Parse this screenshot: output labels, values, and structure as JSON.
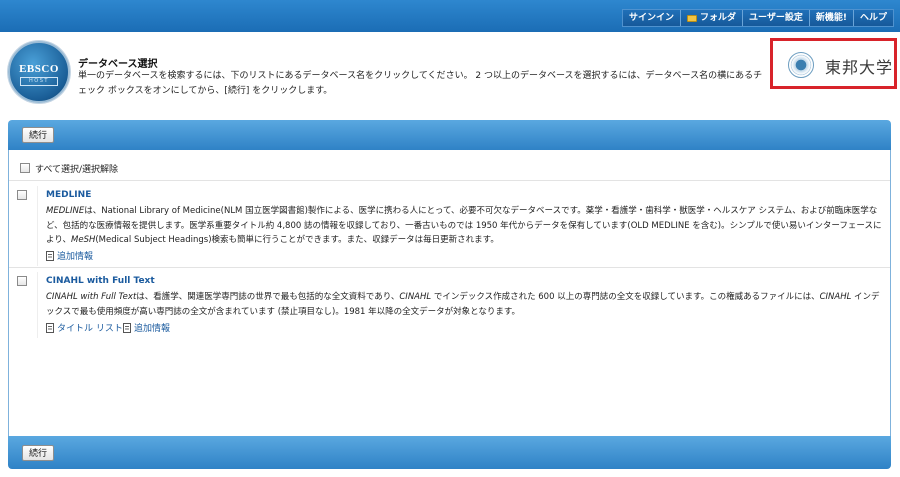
{
  "topnav": {
    "signin": "サインイン",
    "folder": "フォルダ",
    "user_settings": "ユーザー設定",
    "new_features": "新機能!",
    "help": "ヘルプ"
  },
  "header": {
    "logo_text": "EBSCO",
    "logo_sub": "HOST",
    "title": "データベース選択",
    "instructions": "単一のデータベースを検索するには、下のリストにあるデータベース名をクリックしてください。 2 つ以上のデータベースを選択するには、データベース名の横にあるチェック ボックスをオンにしてから、[続行] をクリックします。",
    "university": "東邦大学"
  },
  "toolbar": {
    "continue_label": "続行"
  },
  "select_all_label": "すべて選択/選択解除",
  "databases": [
    {
      "name": "MEDLINE",
      "desc_italic_1": "MEDLINE",
      "desc_1": "は、National Library of Medicine(NLM 国立医学図書館)製作による、医学に携わる人にとって、必要不可欠なデータベースです。薬学・看護学・歯科学・獣医学・ヘルスケア システム、および前臨床医学など、包括的な医療情報を提供します。医学系重要タイトル約 4,800 誌の情報を収録しており、一番古いものでは 1950 年代からデータを保有しています(OLD MEDLINE を含む)。シンプルで使い易いインターフェースにより、",
      "desc_italic_2": "MeSH",
      "desc_2": "(Medical Subject Headings)検索も簡単に行うことができます。また、収録データは毎日更新されます。",
      "more_info": "追加情報"
    },
    {
      "name": "CINAHL with Full Text",
      "desc_italic_1": "CINAHL with Full Text",
      "desc_1": "は、看護学、関連医学専門誌の世界で最も包括的な全文資料であり、",
      "desc_italic_2": "CINAHL",
      "desc_2": " でインデックス作成された 600 以上の専門誌の全文を収録しています。この権威あるファイルには、",
      "desc_italic_3": "CINAHL",
      "desc_3": " インデックスで最も使用頻度が高い専門誌の全文が含まれています (禁止項目なし)。1981 年以降の全文データが対象となります。",
      "title_list": "タイトル リスト",
      "more_info": "追加情報"
    }
  ]
}
